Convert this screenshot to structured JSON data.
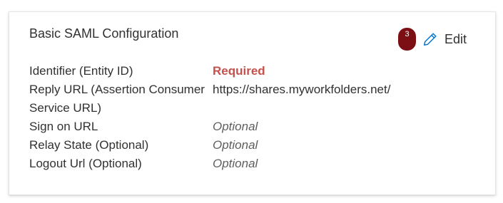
{
  "card": {
    "title": "Basic SAML Configuration",
    "step_badge": "3",
    "edit_label": "Edit",
    "edit_icon": "pencil-icon"
  },
  "properties": [
    {
      "label": "Identifier (Entity ID)",
      "value": "Required",
      "state": "required"
    },
    {
      "label": "Reply URL (Assertion Consumer Service URL)",
      "value": "https://shares.myworkfolders.net/",
      "state": "set"
    },
    {
      "label": "Sign on URL",
      "value": "Optional",
      "state": "optional"
    },
    {
      "label": "Relay State (Optional)",
      "value": "Optional",
      "state": "optional"
    },
    {
      "label": "Logout Url (Optional)",
      "value": "Optional",
      "state": "optional"
    }
  ],
  "colors": {
    "required": "#c4514d",
    "badge": "#7b0f13",
    "accent": "#0078d4"
  }
}
